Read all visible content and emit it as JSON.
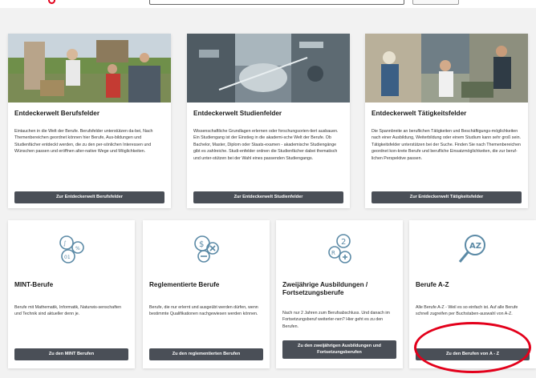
{
  "colors": {
    "accent": "#e3001b",
    "button_bg": "#4a4f57",
    "icon": "#5b8aa6"
  },
  "cards_top": [
    {
      "title": "Entdeckerwelt Berufsfelder",
      "text": "Eintauchen in die Welt der Berufe. Berufsfelder unterstützen da-bei, Nach Themenbereichen geordnet können hier Berufe, Aus-bildungen und Studienfächer entdeckt werden, die zu den per-sönlichen Interessen und Wünschen passen und eröffnen alter-native Wege und Möglichkeiten.",
      "button": "Zur Entdeckerwelt Berufsfelder"
    },
    {
      "title": "Entdeckerwelt Studienfelder",
      "text": "Wissenschaftliche Grundlagen erlernen oder forschungsorien-tiert ausbauen. Ein Studiengang ist der Einstieg in die akademi-sche Welt der Berufe. Ob Bachelor, Master, Diplom oder Staats-examen - akademische Studiengänge gibt es zahlreiche. Studi-enfelder ordnen die Studienfächer dabei thematisch und unter-stützen bei der Wahl eines passenden Studiengangs.",
      "button": "Zur Entdeckerwelt Studienfelder"
    },
    {
      "title": "Entdeckerwelt Tätigkeitsfelder",
      "text": "Die Spannbreite an beruflichen Tätigkeiten und Beschäftigungs-möglichkeiten nach einer Ausbildung, Weiterbildung oder einem Studium kann sehr groß sein. Tätigkeitsfelder unterstützen bei der Suche. Finden Sie nach Themenbereichen geordnet kon-krete Berufe und berufliche Einsatzmöglichkeiten, die zur beruf-lichen Perspektive passen.",
      "button": "Zur Entdeckerwelt Tätigkeitsfelder"
    }
  ],
  "cards_bottom": [
    {
      "title": "MINT-Berufe",
      "text": "Berufe mit Mathematik, Informatik, Naturwis-senschaften und Technik sind aktueller denn je.",
      "button": "Zu den MINT Berufen",
      "icon": "mint-icon"
    },
    {
      "title": "Reglementierte Berufe",
      "text": "Berufe, die nur erlernt und ausgeübt werden dürfen, wenn bestimmte Qualifikationen nachgewiesen werden können.",
      "button": "Zu den reglementierten Berufen",
      "icon": "regulated-icon"
    },
    {
      "title": "Zweijährige Ausbildungen / Fortsetzungsberufe",
      "text": "Nach nur 2 Jahren zum Berufsabschluss. Und danach im Fortsetzungsberuf weiterler-nen? Hier geht es zu den Berufen.",
      "button": "Zu den zweijährigen Ausbildungen und Fortsetzungsberufen",
      "icon": "two-year-icon"
    },
    {
      "title": "Berufe A-Z",
      "text": "Alle Berufe A-Z - Weil es so einfach ist. Auf alle Berufe schnell zugreifen per Buchstaben-auswahl von A-Z.",
      "button": "Zu den Berufen von A - Z",
      "icon": "az-search-icon"
    }
  ]
}
